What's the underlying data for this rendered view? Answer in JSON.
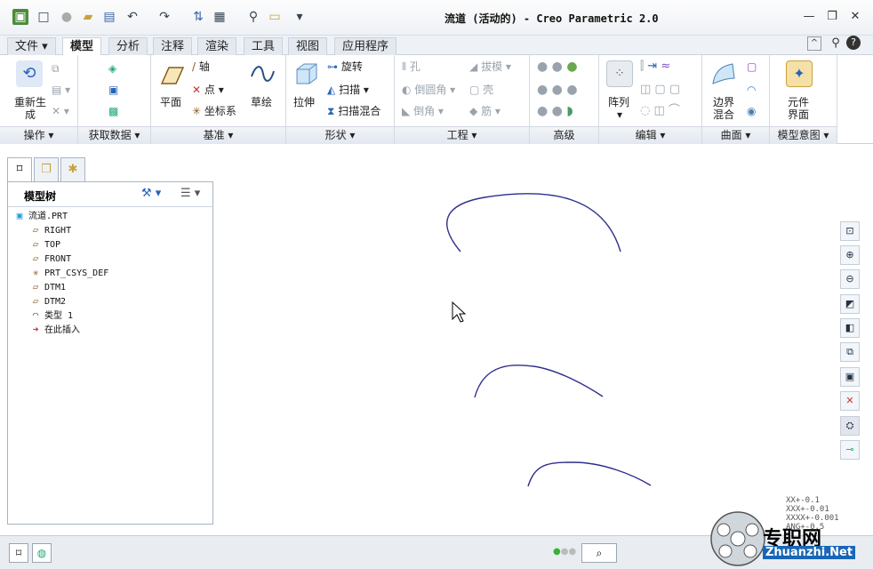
{
  "window": {
    "title": "流道 (活动的) - Creo Parametric 2.0"
  },
  "tabs": [
    "文件",
    "模型",
    "分析",
    "注释",
    "渲染",
    "工具",
    "视图",
    "应用程序"
  ],
  "ribbon": {
    "groups": [
      "操作",
      "获取数据",
      "基准",
      "形状",
      "工程",
      "高级",
      "编辑",
      "曲面",
      "模型意图"
    ],
    "regenerate": "重新生\n成",
    "plane": "平面",
    "axis": "轴",
    "point": "点",
    "csys": "坐标系",
    "sketch": "草绘",
    "extrude": "拉伸",
    "revolve": "旋转",
    "sweep": "扫描",
    "swept_blend": "扫描混合",
    "hole": "孔",
    "draft": "拔模",
    "round": "倒圆角",
    "shell": "壳",
    "chamfer": "倒角",
    "rib": "筋",
    "pattern": "阵列",
    "boundary_blend": "边界\n混合",
    "component_interface": "元件\n界面"
  },
  "model_tree": {
    "title": "模型树",
    "items": [
      {
        "label": "流道.PRT",
        "icon": "part-icon",
        "indent": 0
      },
      {
        "label": "RIGHT",
        "icon": "datum-plane-icon",
        "indent": 1
      },
      {
        "label": "TOP",
        "icon": "datum-plane-icon",
        "indent": 1
      },
      {
        "label": "FRONT",
        "icon": "datum-plane-icon",
        "indent": 1
      },
      {
        "label": "PRT_CSYS_DEF",
        "icon": "csys-icon",
        "indent": 1
      },
      {
        "label": "DTM1",
        "icon": "datum-plane-icon",
        "indent": 1
      },
      {
        "label": "DTM2",
        "icon": "datum-plane-icon",
        "indent": 1
      },
      {
        "label": "类型 1",
        "icon": "sketch-icon",
        "indent": 1
      },
      {
        "label": "在此插入",
        "icon": "insert-arrow-icon",
        "indent": 1
      }
    ]
  },
  "coords": [
    "XX+-0.1",
    "XXX+-0.01",
    "XXXX+-0.001",
    "ANG+-0.5"
  ],
  "watermark": {
    "cn": "专职网",
    "en": "Zhuanzhi.Net"
  },
  "colors": {
    "curve": "#2e2e8f",
    "accent": "#1766b7"
  }
}
